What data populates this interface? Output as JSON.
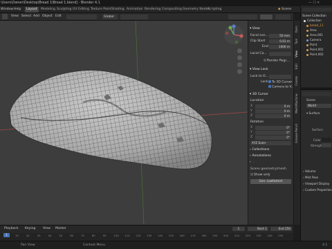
{
  "window": {
    "title": "\\Users\\Owner\\Desktop\\Bread 1\\Bread 1.blend] - Blender 4.1"
  },
  "menu": {
    "items": [
      "Window",
      "Help"
    ]
  },
  "workspaces": [
    "Layout",
    "Modeling",
    "Sculpting",
    "UV Editing",
    "Texture Paint",
    "Shading",
    "Animation",
    "Rendering",
    "Compositing",
    "Geometry Nodes",
    "Scripting"
  ],
  "scene": {
    "label": "Scene"
  },
  "viewport_header": {
    "items": [
      "View",
      "Select",
      "Add",
      "Object",
      "Edit"
    ],
    "orientation": "Global"
  },
  "npanel": {
    "view_title": "View",
    "focal_label": "Focal Len...",
    "focal_value": "50 mm",
    "clip_start_label": "Clip Start",
    "clip_start_value": "0.01 m",
    "clip_end_label": "End",
    "clip_end_value": "1000 m",
    "local_camera_label": "Local Ca...",
    "render_region_label": "Render Regi...",
    "view_lock_title": "View Lock",
    "lock_to_label": "Lock to O...",
    "lock_label": "Lock",
    "lock_cursor_label": "To 3D Cursor",
    "lock_camera_label": "Camera to V...",
    "cursor_title": "3D Cursor",
    "location_label": "Location",
    "loc_x_label": "X",
    "loc_x_value": "0 m",
    "loc_y_label": "Y",
    "loc_y_value": "0 m",
    "loc_z_label": "Z",
    "loc_z_value": "0 m",
    "rotation_label": "Rotation",
    "rot_x_label": "X",
    "rot_x_value": "0°",
    "rot_y_label": "Y",
    "rot_y_value": "0°",
    "rot_z_label": "Z",
    "rot_z_value": "0°",
    "rot_mode": "XYZ Euler",
    "collections_label": "Collections",
    "annotations_label": "Annotations",
    "mesh_title": "Scene geometry/mesh",
    "fields_label": "Show only",
    "apply_button": "Gen. Lowfastest",
    "tabs": [
      "Item",
      "Tool",
      "View",
      "Edit",
      "Create",
      "MeshMachine",
      "Grease Pencil"
    ]
  },
  "outliner": {
    "title": "Scene Collection",
    "items": [
      "Collection",
      "bread_11",
      "Area",
      "Area.001",
      "Camera",
      "Point",
      "Point.001",
      "Point.002"
    ]
  },
  "properties": {
    "scene_label": "Scene",
    "world_label": "World",
    "rows": [
      "Surface",
      "Surface",
      "Color",
      "Strength",
      "Volume",
      "Mist Pass",
      "Viewport Display",
      "Custom Properties"
    ]
  },
  "timeline": {
    "items": [
      "Playback",
      "Keying",
      "View",
      "Marker"
    ],
    "current_frame": "1",
    "start_label": "Start",
    "start_value": "1",
    "end_label": "End",
    "end_value": "250",
    "ticks": [
      "10",
      "20",
      "30",
      "40",
      "50",
      "60",
      "70",
      "80",
      "90",
      "100",
      "110",
      "120",
      "130",
      "140",
      "150",
      "160",
      "170",
      "180",
      "190",
      "200",
      "210",
      "220",
      "230",
      "240",
      "250"
    ]
  },
  "status": {
    "items": [
      "Pan View",
      "Context Menu"
    ],
    "version": "4.1"
  }
}
